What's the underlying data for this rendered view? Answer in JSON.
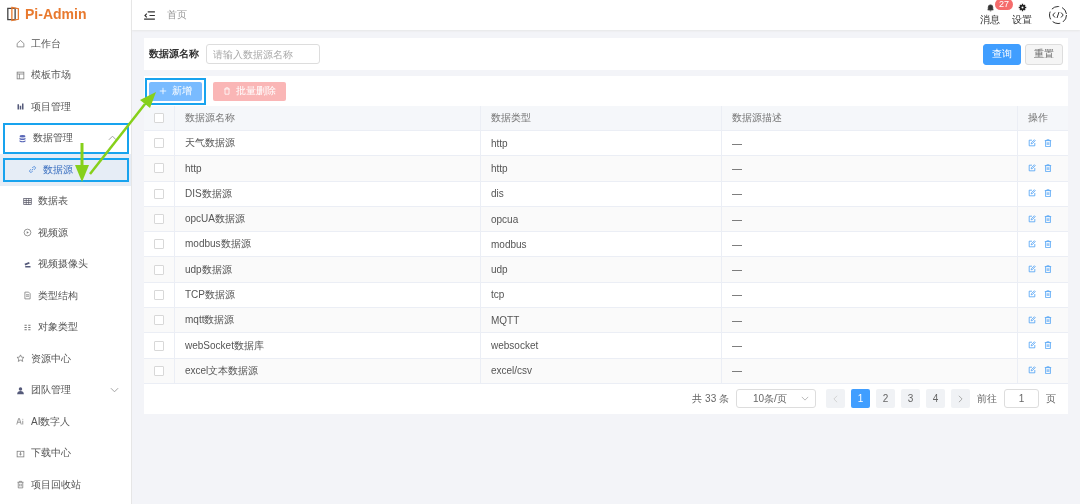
{
  "app": {
    "title": "Pi-Admin"
  },
  "sidebar": {
    "items": [
      {
        "label": "工作台",
        "selected": false,
        "outlined": false
      },
      {
        "label": "模板市场",
        "selected": false,
        "outlined": false
      },
      {
        "label": "项目管理",
        "selected": false,
        "outlined": false
      },
      {
        "label": "数据管理",
        "selected": false,
        "outlined": true,
        "expanded": true,
        "children": [
          {
            "label": "数据源",
            "selected": true,
            "outlined": true
          },
          {
            "label": "数据表",
            "selected": false,
            "outlined": false
          },
          {
            "label": "视频源",
            "selected": false,
            "outlined": false
          },
          {
            "label": "视频摄像头",
            "selected": false,
            "outlined": false
          },
          {
            "label": "类型结构",
            "selected": false,
            "outlined": false
          },
          {
            "label": "对象类型",
            "selected": false,
            "outlined": false
          }
        ]
      },
      {
        "label": "资源中心",
        "selected": false,
        "outlined": false
      },
      {
        "label": "团队管理",
        "selected": false,
        "outlined": false,
        "expanded": false
      },
      {
        "label": "AI数字人",
        "selected": false,
        "outlined": false
      },
      {
        "label": "下载中心",
        "selected": false,
        "outlined": false
      },
      {
        "label": "项目回收站",
        "selected": false,
        "outlined": false
      }
    ]
  },
  "header": {
    "breadcrumb": "首页",
    "messages": {
      "label": "消息",
      "badge": "27"
    },
    "settings": {
      "label": "设置"
    }
  },
  "filter": {
    "label": "数据源名称",
    "placeholder": "请输入数据源名称",
    "buttons": [
      {
        "label": "查询",
        "kind": "primary"
      },
      {
        "label": "重置",
        "kind": "default"
      }
    ]
  },
  "toolbar": {
    "buttons": [
      {
        "label": "新增",
        "kind": "add",
        "disabled": false,
        "outlined": true
      },
      {
        "label": "批量删除",
        "kind": "delete",
        "disabled": true,
        "outlined": false
      }
    ]
  },
  "table": {
    "all_checked": false,
    "columns": [
      "数据源名称",
      "数据类型",
      "数据源描述",
      "操作"
    ],
    "rows": [
      {
        "name": "天气数据源",
        "type": "http",
        "description": "—",
        "checked": false
      },
      {
        "name": "http",
        "type": "http",
        "description": "—",
        "checked": false
      },
      {
        "name": "DIS数据源",
        "type": "dis",
        "description": "—",
        "checked": false
      },
      {
        "name": "opcUA数据源",
        "type": "opcua",
        "description": "—",
        "checked": false
      },
      {
        "name": "modbus数据源",
        "type": "modbus",
        "description": "—",
        "checked": false
      },
      {
        "name": "udp数据源",
        "type": "udp",
        "description": "—",
        "checked": false
      },
      {
        "name": "TCP数据源",
        "type": "tcp",
        "description": "—",
        "checked": false
      },
      {
        "name": "mqtt数据源",
        "type": "MQTT",
        "description": "—",
        "checked": false
      },
      {
        "name": "webSocket数据库",
        "type": "websocket",
        "description": "—",
        "checked": false
      },
      {
        "name": "excel文本数据源",
        "type": "excel/csv",
        "description": "—",
        "checked": false
      }
    ]
  },
  "pagination": {
    "total": "共 33 条",
    "page_size": "10条/页",
    "pages": [
      {
        "label": "1",
        "selected": true
      },
      {
        "label": "2",
        "selected": false
      },
      {
        "label": "3",
        "selected": false
      },
      {
        "label": "4",
        "selected": false
      }
    ],
    "goto_label": "前往",
    "goto_value": "1",
    "goto_suffix": "页"
  }
}
